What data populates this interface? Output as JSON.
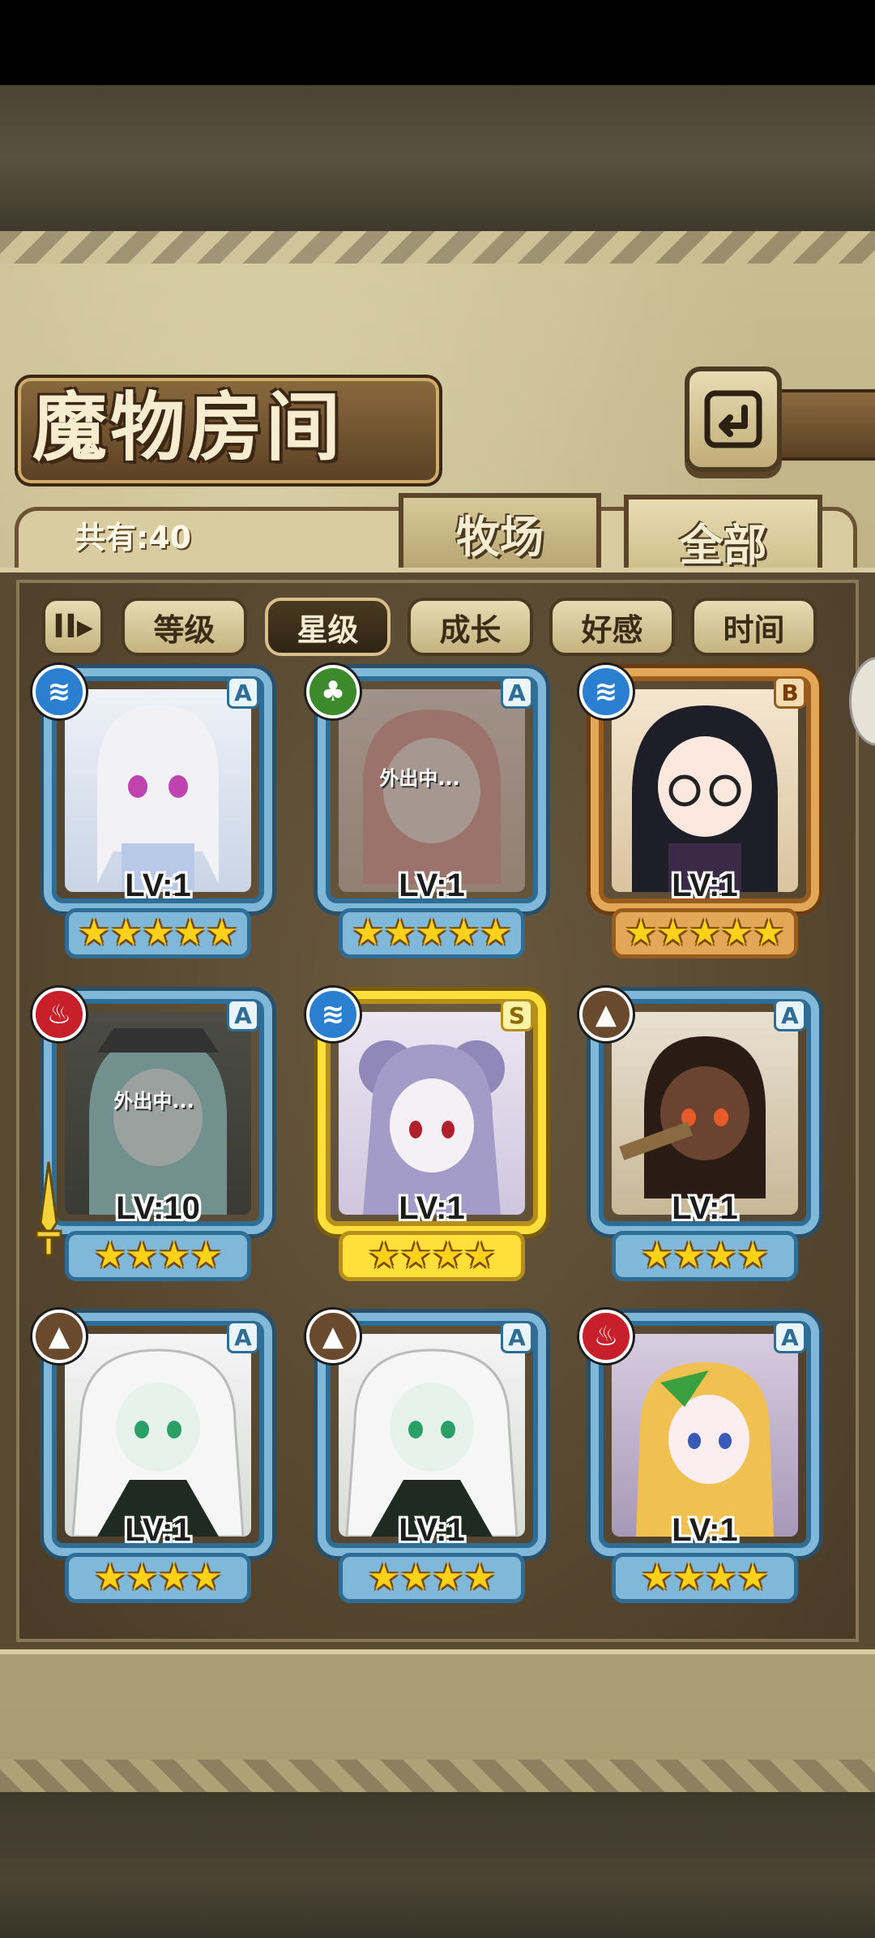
{
  "header": {
    "title": "魔物房间",
    "count_label": "共有:40"
  },
  "tabs": [
    {
      "label": "牧场",
      "selected": false
    },
    {
      "label": "全部",
      "selected": true
    }
  ],
  "sort": {
    "toggle_icon": "II▸",
    "buttons": [
      {
        "label": "等级",
        "active": false
      },
      {
        "label": "星级",
        "active": true
      },
      {
        "label": "成长",
        "active": false
      },
      {
        "label": "好感",
        "active": false
      },
      {
        "label": "时间",
        "active": false
      }
    ]
  },
  "monsters": [
    {
      "element": "water",
      "rank": "A",
      "level": "LV:1",
      "stars": "★★★★★",
      "status": "",
      "frame": "blue"
    },
    {
      "element": "grass",
      "rank": "A",
      "level": "LV:1",
      "stars": "★★★★★",
      "status": "外出中...",
      "frame": "blue"
    },
    {
      "element": "water",
      "rank": "B",
      "level": "LV:1",
      "stars": "★★★★★",
      "status": "",
      "frame": "gold"
    },
    {
      "element": "fire",
      "rank": "A",
      "level": "LV:10",
      "stars": "★★★★",
      "status": "外出中...",
      "frame": "blue"
    },
    {
      "element": "water",
      "rank": "S",
      "level": "LV:1",
      "stars": "★★★★",
      "status": "",
      "frame": "yellow"
    },
    {
      "element": "earth",
      "rank": "A",
      "level": "LV:1",
      "stars": "★★★★",
      "status": "",
      "frame": "blue"
    },
    {
      "element": "earth",
      "rank": "A",
      "level": "LV:1",
      "stars": "★★★★",
      "status": "",
      "frame": "blue"
    },
    {
      "element": "earth",
      "rank": "A",
      "level": "LV:1",
      "stars": "★★★★",
      "status": "",
      "frame": "blue"
    },
    {
      "element": "fire",
      "rank": "A",
      "level": "LV:1",
      "stars": "★★★★",
      "status": "",
      "frame": "blue"
    }
  ],
  "colors": {
    "water": "#2a7fd0",
    "grass": "#3d8a2c",
    "fire": "#c8202a",
    "earth": "#6a4a2c",
    "frame_blue": "#7fb8d9",
    "frame_gold": "#e3a758",
    "frame_yellow": "#ffe03a"
  }
}
